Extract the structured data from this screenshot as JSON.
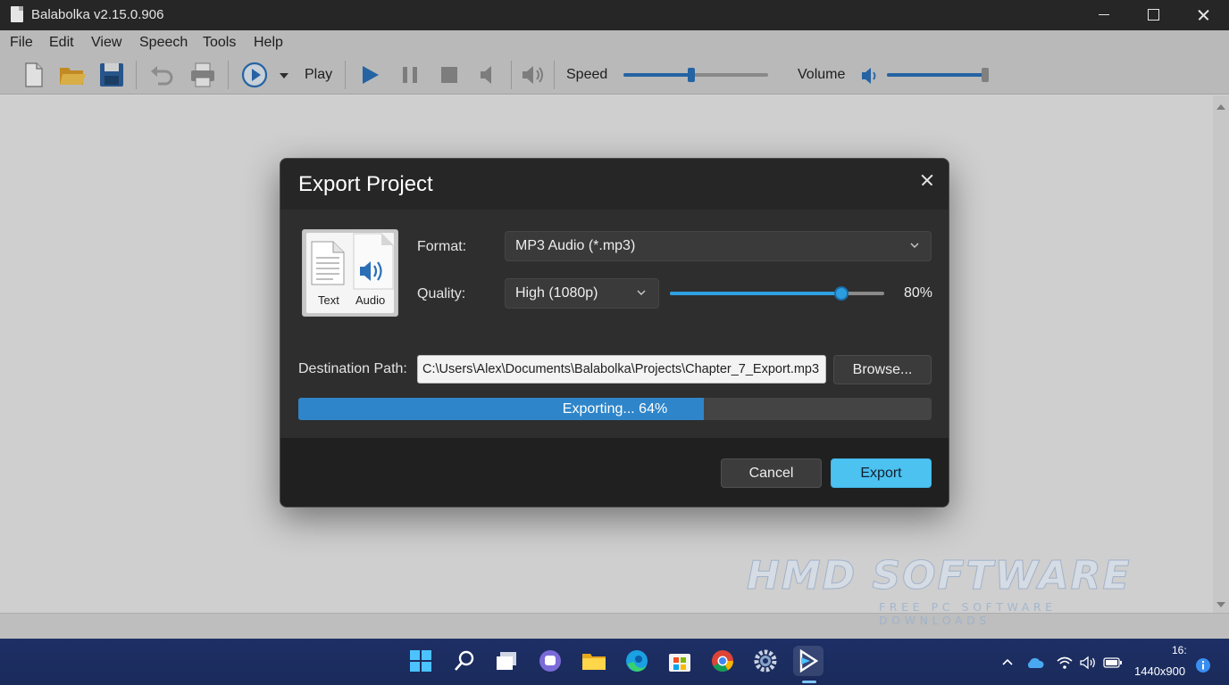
{
  "window": {
    "title": "Balabolka v2.15.0.906"
  },
  "menu": {
    "items": [
      {
        "label": "File"
      },
      {
        "label": "Edit"
      },
      {
        "label": "View"
      },
      {
        "label": "Speech"
      },
      {
        "label": "Tools"
      },
      {
        "label": "Help"
      }
    ]
  },
  "toolbar": {
    "play_label": "Play",
    "speed_label": "Speed",
    "volume_label": "Volume",
    "speed_level": 0.47,
    "volume_level": 0.97,
    "icons": [
      "new-document-icon",
      "open-folder-icon",
      "save-icon",
      "undo-icon",
      "print-icon",
      "play-circle-icon",
      "play-icon",
      "pause-icon",
      "stop-icon",
      "mute-icon",
      "speaker-icon"
    ]
  },
  "dialog": {
    "title": "Export Project",
    "icon_captions": {
      "text": "Text",
      "audio": "Audio"
    },
    "format": {
      "label": "Format:",
      "value": "MP3 Audio (*.mp3)"
    },
    "quality": {
      "label": "Quality:",
      "value": "High (1080p)",
      "percent": 80,
      "percent_text": "80%"
    },
    "destination": {
      "label": "Destination Path:",
      "value": "C:\\Users\\Alex\\Documents\\Balabolka\\Projects\\Chapter_7_Export.mp3"
    },
    "browse_label": "Browse...",
    "progress": {
      "percent": 64,
      "text": "Exporting... 64%"
    },
    "cancel_label": "Cancel",
    "export_label": "Export"
  },
  "watermark": {
    "title": "HMD SOFTWARE",
    "subtitle": "FREE PC SOFTWARE DOWNLOADS"
  },
  "taskbar": {
    "apps": [
      "windows-start-icon",
      "search-icon",
      "task-view-icon",
      "teams-chat-icon",
      "file-explorer-icon",
      "edge-icon",
      "microsoft-store-icon",
      "chrome-icon",
      "settings-icon",
      "balabolka-icon"
    ],
    "time": "16:",
    "resolution": "1440x900"
  },
  "colors": {
    "accent": "#4cc2f1",
    "progress": "#2f85c9",
    "dialog_bg": "#2d2d2d"
  }
}
